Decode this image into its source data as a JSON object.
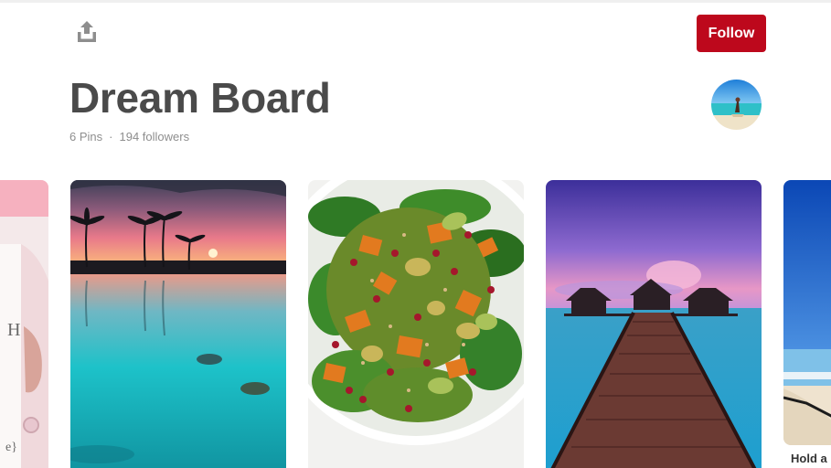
{
  "header": {
    "share_icon": "share-upload-icon",
    "follow_label": "Follow",
    "colors": {
      "follow_bg": "#bd081c",
      "title": "#4a4a4a",
      "meta": "#8e8e8e"
    }
  },
  "board": {
    "title": "Dream Board",
    "pins": "6 Pins",
    "separator": "·",
    "followers": "194 followers"
  },
  "pins": [
    {
      "id": "partial-left",
      "desc": "pink book cover with jewelry",
      "visible_text_top": "H",
      "visible_text_bottom": "e}"
    },
    {
      "id": "sunset",
      "desc": "tropical sunset with palm trees and sea turtles"
    },
    {
      "id": "salad",
      "desc": "spinach salad with roasted squash and pomegranate"
    },
    {
      "id": "villa",
      "desc": "overwater bungalows with wooden pier at dusk"
    },
    {
      "id": "partial-right",
      "desc": "beach with blue sky",
      "caption": "Hold a"
    }
  ]
}
